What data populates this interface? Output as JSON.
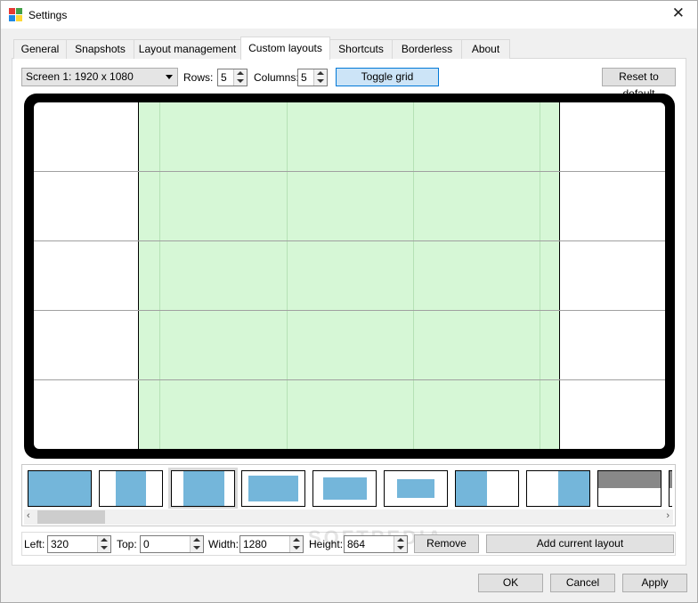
{
  "window": {
    "title": "Settings",
    "close_glyph": "✕"
  },
  "tabs": [
    {
      "label": "General"
    },
    {
      "label": "Snapshots"
    },
    {
      "label": "Layout management"
    },
    {
      "label": "Custom layouts",
      "active": true
    },
    {
      "label": "Shortcuts"
    },
    {
      "label": "Borderless"
    },
    {
      "label": "About"
    }
  ],
  "toolbar": {
    "screen_select": "Screen 1: 1920 x 1080",
    "rows_label": "Rows:",
    "rows_value": "5",
    "columns_label": "Columns:",
    "columns_value": "5",
    "toggle_grid": "Toggle grid",
    "reset_default": "Reset to default"
  },
  "grid": {
    "rows": 5,
    "columns": 5,
    "selection_color": "#d6f7d6"
  },
  "thumbnails": {
    "icons": [
      "layout-full-icon",
      "layout-right-icon",
      "layout-center-icon",
      "layout-wide-icon",
      "layout-medium-icon",
      "layout-small-icon",
      "layout-left-icon",
      "layout-right-half-icon",
      "layout-top-icon",
      "layout-partial-icon"
    ],
    "fill_color": "#74b6da"
  },
  "layout_fields": {
    "left_label": "Left:",
    "left_value": "320",
    "top_label": "Top:",
    "top_value": "0",
    "width_label": "Width:",
    "width_value": "1280",
    "height_label": "Height:",
    "height_value": "864",
    "remove": "Remove",
    "add_current": "Add current layout"
  },
  "dialog_buttons": {
    "ok": "OK",
    "cancel": "Cancel",
    "apply": "Apply"
  },
  "watermark": "SOFTPEDIA"
}
